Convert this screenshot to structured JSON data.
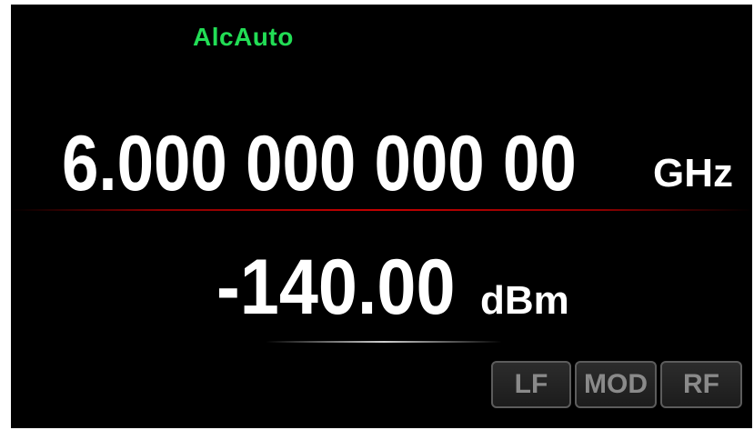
{
  "status": {
    "alc_mode": "AlcAuto",
    "alc_color": "#22dd55"
  },
  "frequency": {
    "value": "6.000 000 000 00",
    "unit": "GHz",
    "underline_color": "#c40000"
  },
  "power": {
    "value": "-140.00",
    "unit": "dBm"
  },
  "buttons": {
    "lf_label": "LF",
    "mod_label": "MOD",
    "rf_label": "RF"
  }
}
